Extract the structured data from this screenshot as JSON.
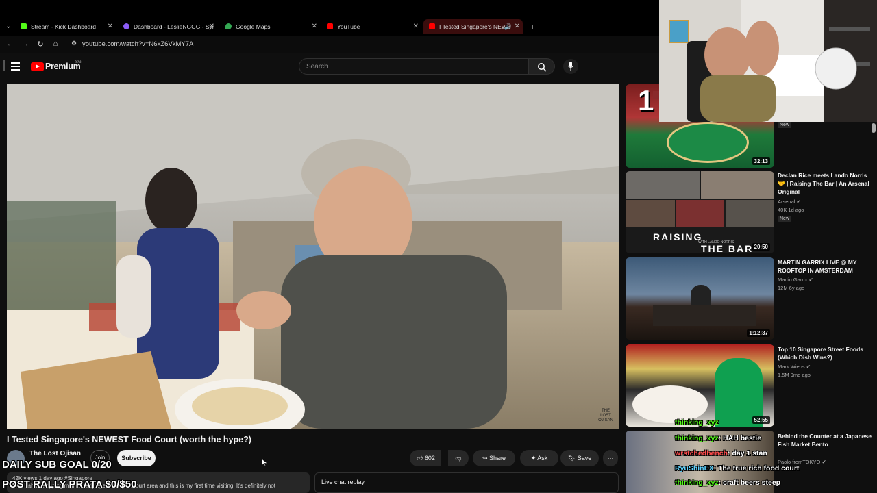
{
  "browser": {
    "tabs": [
      {
        "title": "Stream - Kick Dashboard",
        "color": "#53fc18"
      },
      {
        "title": "Dashboard - LeslieNGGG - Syn",
        "color": "#8b5cf6"
      },
      {
        "title": "Google Maps",
        "color": "#34a853"
      },
      {
        "title": "YouTube",
        "color": "#ff0000"
      },
      {
        "title": "I Tested Singapore's NEWE",
        "color": "#ff0000"
      }
    ],
    "url": "youtube.com/watch?v=N6xZ6VkMY7A"
  },
  "youtube": {
    "logo_text": "Premium",
    "logo_badge": "SG",
    "search_placeholder": "Search"
  },
  "video": {
    "title": "I Tested Singapore's NEWEST Food Court (worth the hype?)",
    "channel": "The Lost Ojisan",
    "join_label": "Join",
    "subscribe_label": "Subscribe",
    "likes": "602",
    "share_label": "Share",
    "ask_label": "Ask",
    "save_label": "Save",
    "description_snippet": "New bahru shopping mall recently opened a food court area and this is my first time visiting. It's definitely not",
    "views_snippet": "42K views  1 day ago  #Singapore",
    "live_chat_label": "Live chat replay",
    "watermark": "THE LOST OJISAN"
  },
  "recommendations": [
    {
      "title": "",
      "channel": "",
      "meta": "",
      "duration": "32:13",
      "badge": "New"
    },
    {
      "title": "Declan Rice meets Lando Norris 🤝 | Raising The Bar | An Arsenal Original",
      "channel": "Arsenal",
      "meta": "40K  1d ago",
      "duration": "20:50",
      "badge": "New",
      "thumb_text_1": "RAISING",
      "thumb_text_2": "THE BAR",
      "thumb_small": "WITH LANDO NORRIS"
    },
    {
      "title": "MARTIN GARRIX LIVE @ MY ROOFTOP IN AMSTERDAM",
      "channel": "Martin Garrix",
      "meta": "12M  6y ago",
      "duration": "1:12:37",
      "badge": ""
    },
    {
      "title": "Top 10 Singapore Street Foods (Which Dish Wins?)",
      "channel": "Mark Wiens",
      "meta": "1.5M  9mo ago",
      "duration": "52:55",
      "badge": ""
    },
    {
      "title": "Behind the Counter at a Japanese Fish Market Bento",
      "channel": "Paolo fromTOKYO",
      "meta": "",
      "duration": "",
      "badge": ""
    }
  ],
  "overlay": {
    "sub_goal": "DAILY SUB GOAL 0/20",
    "post_rally": "POST RALLY PRATA $0/$50",
    "thumb_banner": "1"
  },
  "chat": [
    {
      "user": "thinking_xyz",
      "message": "",
      "color": "#53fc18"
    },
    {
      "user": "thinking_xyz",
      "message": "HAH bestie",
      "color": "#53fc18"
    },
    {
      "user": "wrstchedbench",
      "message": "day 1 stan",
      "color": "#ff4d4d"
    },
    {
      "user": "RyuShinEX",
      "message": "The true rich food court",
      "color": "#5fd3ff"
    },
    {
      "user": "thinking_xyz",
      "message": "craft beers steep",
      "color": "#53fc18"
    }
  ],
  "colors": {
    "accent": "#ff0000",
    "bg": "#0f0f0f",
    "chip": "#272727"
  }
}
